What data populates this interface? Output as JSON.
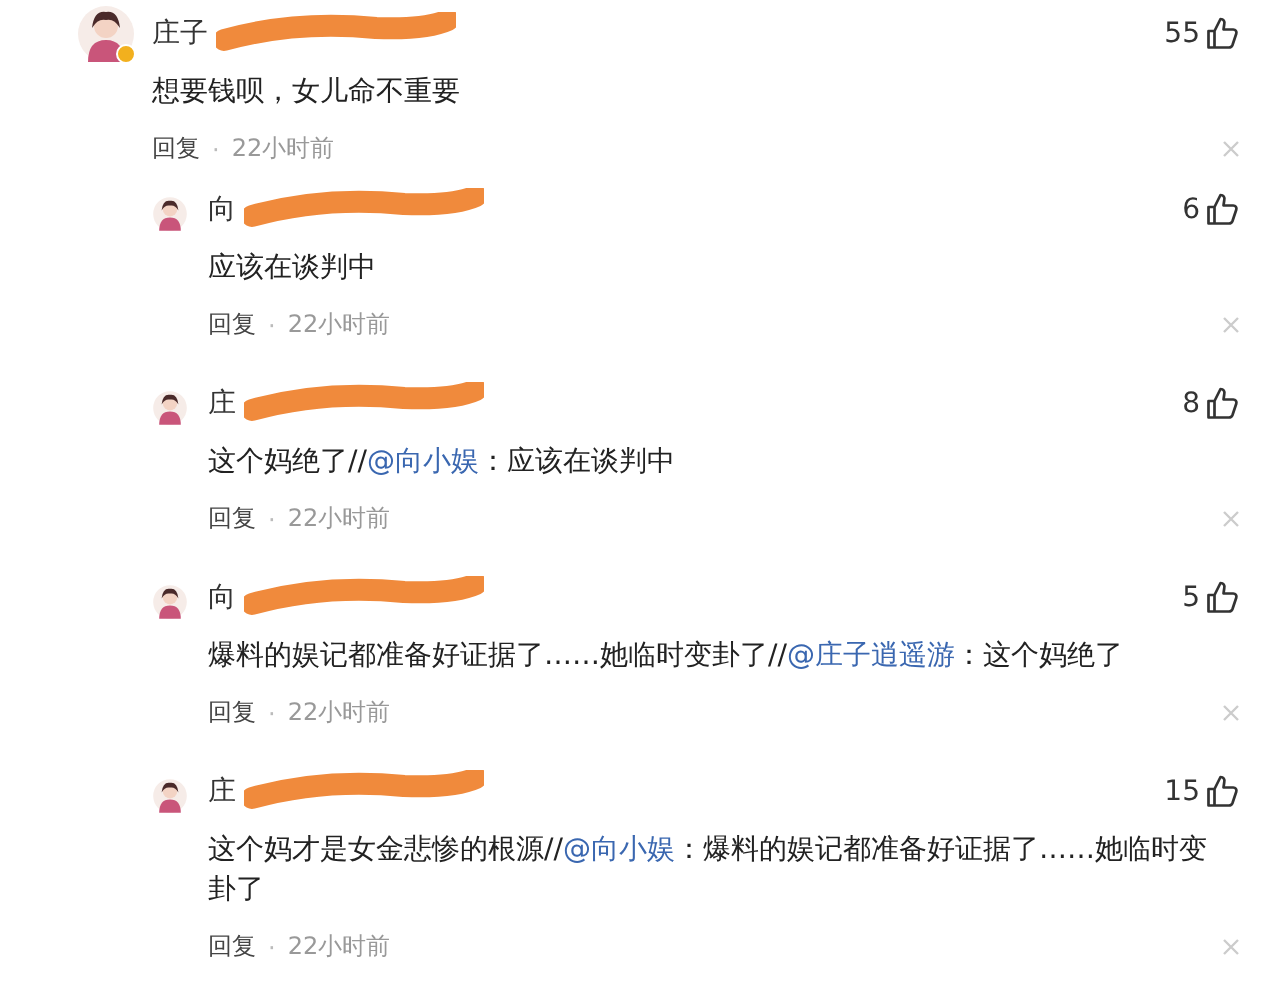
{
  "separator": "·",
  "comments": [
    {
      "kind": "top",
      "name": "庄子",
      "redacted": true,
      "verified": true,
      "likes": "55",
      "body": [
        {
          "kind": "plain",
          "text": "想要钱呗，女儿命不重要"
        }
      ],
      "reply": "回复",
      "time": "22小时前"
    },
    {
      "kind": "reply",
      "name": "向",
      "redacted": true,
      "verified": false,
      "likes": "6",
      "body": [
        {
          "kind": "plain",
          "text": "应该在谈判中"
        }
      ],
      "reply": "回复",
      "time": "22小时前"
    },
    {
      "kind": "reply",
      "name": "庄",
      "redacted": true,
      "verified": false,
      "likes": "8",
      "body": [
        {
          "kind": "plain",
          "text": "这个妈绝了//"
        },
        {
          "kind": "mention",
          "text": "@向小娱"
        },
        {
          "kind": "plain",
          "text": "：应该在谈判中"
        }
      ],
      "reply": "回复",
      "time": "22小时前"
    },
    {
      "kind": "reply",
      "name": "向",
      "redacted": true,
      "verified": false,
      "likes": "5",
      "body": [
        {
          "kind": "plain",
          "text": "爆料的娱记都准备好证据了……她临时变卦了//"
        },
        {
          "kind": "mention",
          "text": "@庄子逍遥游"
        },
        {
          "kind": "plain",
          "text": "：这个妈绝了"
        }
      ],
      "reply": "回复",
      "time": "22小时前"
    },
    {
      "kind": "reply",
      "name": "庄",
      "redacted": true,
      "verified": false,
      "likes": "15",
      "body": [
        {
          "kind": "plain",
          "text": "这个妈才是女金悲惨的根源//"
        },
        {
          "kind": "mention",
          "text": "@向小娱"
        },
        {
          "kind": "plain",
          "text": "：爆料的娱记都准备好证据了……她临时变卦了"
        }
      ],
      "reply": "回复",
      "time": "22小时前"
    }
  ]
}
